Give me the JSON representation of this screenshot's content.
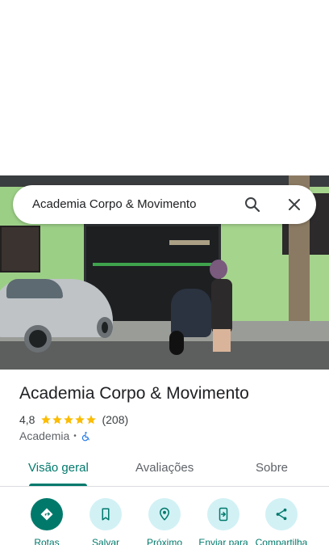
{
  "search": {
    "query": "Academia Corpo & Movimento",
    "search_icon": "search-icon",
    "close_icon": "close-icon"
  },
  "photo": {
    "description_icon": "street-view-photo"
  },
  "place": {
    "title": "Academia Corpo & Movimento",
    "rating": "4,8",
    "stars": 5,
    "review_count": "(208)",
    "category": "Academia",
    "separator": "•",
    "accessibility_icon": "wheelchair-icon"
  },
  "tabs": [
    {
      "label": "Visão geral",
      "active": true
    },
    {
      "label": "Avaliações",
      "active": false
    },
    {
      "label": "Sobre",
      "active": false
    }
  ],
  "actions": [
    {
      "label": "Rotas",
      "icon": "directions-icon"
    },
    {
      "label": "Salvar",
      "icon": "bookmark-icon"
    },
    {
      "label": "Próximo",
      "icon": "nearby-icon"
    },
    {
      "label": "Enviar para",
      "icon": "send-to-phone-icon"
    },
    {
      "label": "Compartilha",
      "icon": "share-icon"
    }
  ],
  "colors": {
    "accent": "#00796b",
    "chip_bg": "#d2f1f5",
    "star": "#fbbc04",
    "text": "#202124"
  }
}
